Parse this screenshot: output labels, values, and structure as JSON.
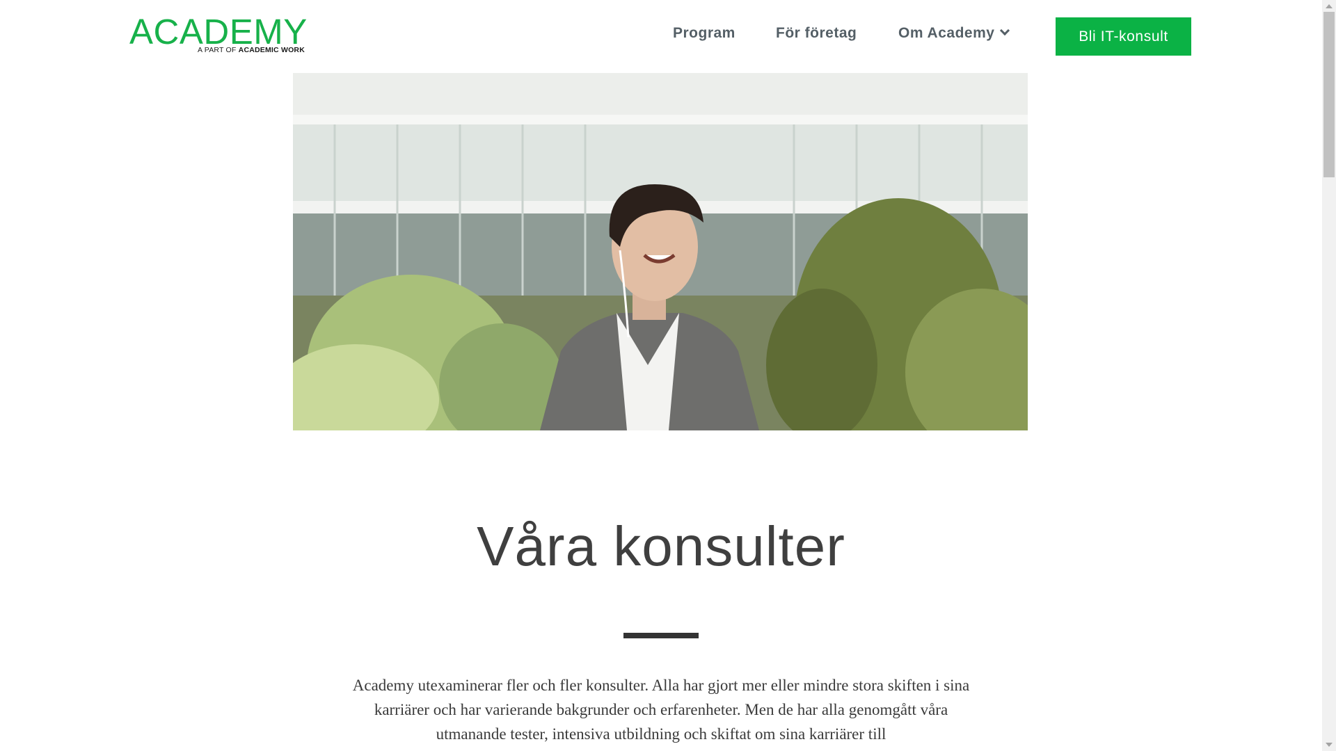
{
  "brand": {
    "logo_text": "ACADEMY",
    "logo_sub_prefix": "A PART OF",
    "logo_sub_strong": "ACADEMIC WORK",
    "accent_color": "#0bb245"
  },
  "nav": {
    "items": [
      {
        "label": "Program"
      },
      {
        "label": "För företag"
      },
      {
        "label": "Om Academy",
        "icon": "chevron-down-icon"
      }
    ],
    "cta_label": "Bli IT-konsult"
  },
  "hero": {
    "image_alt": "Smiling man with earphones in a grey cardigan outdoors"
  },
  "main": {
    "title": "Våra konsulter",
    "intro": "Academy utexaminerar fler och fler konsulter. Alla har gjort mer eller mindre stora skiften i sina karriärer och har varierande bakgrunder och erfarenheter. Men de har alla genomgått våra utmanande tester, intensiva utbildning och skiftat om sina karriärer till"
  }
}
